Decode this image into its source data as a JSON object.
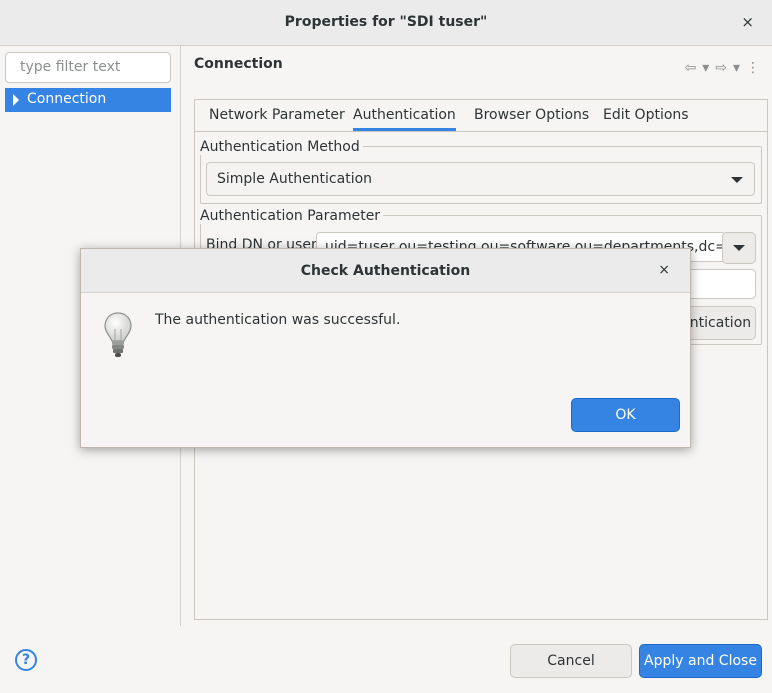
{
  "window": {
    "title": "Properties for \"SDI tuser\"",
    "close_glyph": "×"
  },
  "sidebar": {
    "filter_placeholder": "type filter text",
    "items": [
      {
        "label": "Connection"
      }
    ]
  },
  "main": {
    "title": "Connection",
    "tabs": [
      {
        "label": "Network Parameter"
      },
      {
        "label": "Authentication"
      },
      {
        "label": "Browser Options"
      },
      {
        "label": "Edit Options"
      }
    ],
    "auth_method": {
      "group_label": "Authentication Method",
      "selected": "Simple Authentication"
    },
    "auth_param": {
      "group_label": "Authentication Parameter",
      "bind_dn_label": "Bind DN or user:",
      "bind_dn_value": "uid=tuser,ou=testing,ou=software,ou=departments,dc=beti",
      "check_button_label": "Check Authentication"
    }
  },
  "footer": {
    "help_glyph": "?",
    "cancel_label": "Cancel",
    "apply_label": "Apply and Close"
  },
  "dialog": {
    "title": "Check Authentication",
    "close_glyph": "×",
    "message": "The authentication was successful.",
    "ok_label": "OK"
  },
  "colors": {
    "accent": "#3584e4",
    "background": "#f6f5f4",
    "titlebar": "#ebebeb"
  }
}
